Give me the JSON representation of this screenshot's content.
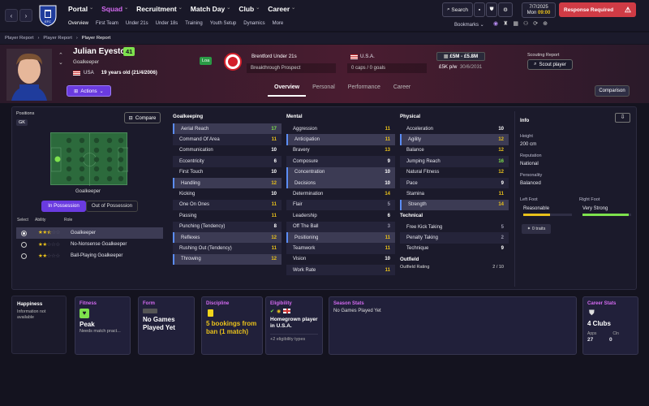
{
  "nav": {
    "back_icon": "chevron-left-icon",
    "fwd_icon": "chevron-right-icon",
    "menu": [
      "Portal",
      "Squad",
      "Recruitment",
      "Match Day",
      "Club",
      "Career"
    ],
    "selected": "Squad",
    "sub": [
      "Overview",
      "First Team",
      "Under 21s",
      "Under 18s",
      "Training",
      "Youth Setup",
      "Dynamics",
      "More"
    ],
    "search": "Search",
    "date": "7/7/2025",
    "day": "Mon",
    "time": "09:00",
    "response": "Response Required",
    "bookmarks": "Bookmarks"
  },
  "breadcrumb": [
    "Player Report",
    "Player Report",
    "Player Report"
  ],
  "player": {
    "name": "Julian Eyestone",
    "ca": "41",
    "position": "Goalkeeper",
    "nation": "USA",
    "age": "19 years old (21/4/2006)",
    "loan": "Loa",
    "club": "Brentford Under 21s",
    "role_desc": "Breakthrough Prospect",
    "country": "U.S.A.",
    "caps": "0 caps / 0 goals",
    "value": "£5M - £5.8M",
    "wage": "£5K p/w",
    "contract": "30/6/2031",
    "scouting": "Scouting Report",
    "scout_btn": "Scout player",
    "actions": "Actions"
  },
  "tabs": [
    "Overview",
    "Personal",
    "Performance",
    "Career"
  ],
  "comparison": "Comparison",
  "left": {
    "positions": "Positions",
    "gk": "GK",
    "compare": "Compare",
    "pitch_label": "Goalkeeper",
    "in_pos": "In Possession",
    "out_pos": "Out of Possession",
    "col_select": "Select",
    "col_ability": "Ability",
    "col_role": "Role",
    "roles": [
      {
        "name": "Goalkeeper",
        "stars": 2.5
      },
      {
        "name": "No-Nonsense Goalkeeper",
        "stars": 2
      },
      {
        "name": "Ball-Playing Goalkeeper",
        "stars": 2
      }
    ]
  },
  "attrs": {
    "gk_title": "Goalkeeping",
    "gk": [
      [
        "Aerial Reach",
        "17"
      ],
      [
        "Command Of Area",
        "11"
      ],
      [
        "Communication",
        "10"
      ],
      [
        "Eccentricity",
        "6"
      ],
      [
        "First Touch",
        "10"
      ],
      [
        "Handling",
        "12"
      ],
      [
        "Kicking",
        "10"
      ],
      [
        "One On Ones",
        "11"
      ],
      [
        "Passing",
        "11"
      ],
      [
        "Punching (Tendency)",
        "8"
      ],
      [
        "Reflexes",
        "12"
      ],
      [
        "Rushing Out (Tendency)",
        "11"
      ],
      [
        "Throwing",
        "12"
      ]
    ],
    "mental_title": "Mental",
    "mental": [
      [
        "Aggression",
        "11"
      ],
      [
        "Anticipation",
        "11"
      ],
      [
        "Bravery",
        "13"
      ],
      [
        "Composure",
        "9"
      ],
      [
        "Concentration",
        "10"
      ],
      [
        "Decisions",
        "10"
      ],
      [
        "Determination",
        "14"
      ],
      [
        "Flair",
        "5"
      ],
      [
        "Leadership",
        "6"
      ],
      [
        "Off The Ball",
        "3"
      ],
      [
        "Positioning",
        "11"
      ],
      [
        "Teamwork",
        "11"
      ],
      [
        "Vision",
        "10"
      ],
      [
        "Work Rate",
        "11"
      ]
    ],
    "physical_title": "Physical",
    "physical": [
      [
        "Acceleration",
        "10"
      ],
      [
        "Agility",
        "12"
      ],
      [
        "Balance",
        "12"
      ],
      [
        "Jumping Reach",
        "16"
      ],
      [
        "Natural Fitness",
        "12"
      ],
      [
        "Pace",
        "9"
      ],
      [
        "Stamina",
        "11"
      ],
      [
        "Strength",
        "14"
      ]
    ],
    "technical_title": "Technical",
    "technical": [
      [
        "Free Kick Taking",
        "5"
      ],
      [
        "Penalty Taking",
        "2"
      ],
      [
        "Technique",
        "9"
      ]
    ],
    "outfield_title": "Outfield",
    "outfield_label": "Outfield Rating",
    "outfield_value": "2 / 10"
  },
  "info": {
    "title": "Info",
    "height_l": "Height",
    "height": "200 cm",
    "rep_l": "Reputation",
    "rep": "National",
    "pers_l": "Personality",
    "pers": "Balanced",
    "lf_l": "Left Foot",
    "lf": "Reasonable",
    "rf_l": "Right Foot",
    "rf": "Very Strong",
    "traits": "0 traits"
  },
  "cards": {
    "happiness": "Happiness",
    "happy_text": "Information not available",
    "fitness": "Fitness",
    "fit_v": "Peak",
    "fit_s": "Needs match pract...",
    "form": "Form",
    "form_v": "No Games Played Yet",
    "discipline": "Discipline",
    "disc_v": "5 bookings from ban (1 match)",
    "eligibility": "Eligibility",
    "elig_v": "Homegrown player in U.S.A.",
    "elig_s": "+2 eligibility types",
    "season": "Season Stats",
    "season_v": "No Games Played Yet",
    "career": "Career Stats",
    "career_v": "4 Clubs",
    "apps_l": "Apps",
    "apps": "27",
    "cln_l": "Cln",
    "cln": "0"
  },
  "colors": {
    "accent": "#d36af0",
    "attr_good": "#7ee24d",
    "attr_mid": "#e9c11b",
    "response": "#cf3b45",
    "primary": "#6a3be0"
  }
}
